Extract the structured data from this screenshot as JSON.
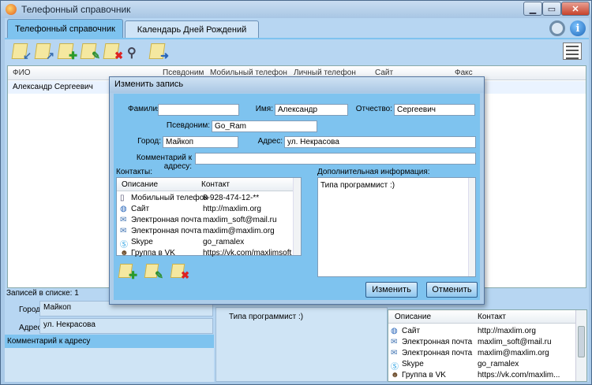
{
  "window": {
    "title": "Телефонный справочник"
  },
  "tabs": [
    {
      "label": "Телефонный справочник",
      "active": true
    },
    {
      "label": "Календарь Дней Рождений",
      "active": false
    }
  ],
  "toolbar": {
    "icons": [
      "import-icon",
      "export-icon",
      "add-icon",
      "edit-icon",
      "delete-icon",
      "search-icon",
      "send-icon"
    ],
    "right_icons": [
      "settings-icon",
      "info-icon",
      "list-view-icon"
    ]
  },
  "grid": {
    "columns": [
      "ФИО",
      "Псевдоним",
      "Мобильный телефон",
      "Личный телефон",
      "Сайт",
      "Факс"
    ],
    "rows": [
      {
        "fio": "Александр Сергеевич"
      }
    ]
  },
  "status": {
    "count_label": "Записей в списке: 1"
  },
  "details": {
    "city_label": "Город",
    "city_value": "Майкоп",
    "address_label": "Адрес",
    "address_value": "ул. Некрасова",
    "comment_header": "Комментарий к адресу",
    "info_text": "Типа программист :)"
  },
  "mini_contacts": {
    "columns": [
      "Описание",
      "Контакт"
    ],
    "rows": [
      {
        "desc": "Сайт",
        "value": "http://maxlim.org"
      },
      {
        "desc": "Электронная почта",
        "value": "maxlim_soft@mail.ru"
      },
      {
        "desc": "Электронная почта",
        "value": "maxlim@maxlim.org"
      },
      {
        "desc": "Skype",
        "value": "go_ramalex"
      },
      {
        "desc": "Группа в VK",
        "value": "https://vk.com/maxlim..."
      }
    ]
  },
  "dialog": {
    "title": "Изменить запись",
    "labels": {
      "last_name": "Фамилия:",
      "first_name": "Имя:",
      "patronymic": "Отчество:",
      "nickname": "Псевдоним:",
      "city": "Город:",
      "address": "Адрес:",
      "address_comment": "Комментарий к адресу:",
      "contacts": "Контакты:",
      "extra_info": "Дополнительная информация:"
    },
    "values": {
      "last_name": "",
      "first_name": "Александр",
      "patronymic": "Сергеевич",
      "nickname": "Go_Ram",
      "city": "Майкоп",
      "address": "ул. Некрасова",
      "address_comment": "",
      "extra_info": "Типа программист :)"
    },
    "contacts": {
      "columns": [
        "Описание",
        "Контакт"
      ],
      "rows": [
        {
          "desc": "Мобильный телефон",
          "value": "8-928-474-12-**",
          "icon": "phone-icon"
        },
        {
          "desc": "Сайт",
          "value": "http://maxlim.org",
          "icon": "globe-icon"
        },
        {
          "desc": "Электронная почта",
          "value": "maxlim_soft@mail.ru",
          "icon": "mail-icon"
        },
        {
          "desc": "Электронная почта",
          "value": "maxlim@maxlim.org",
          "icon": "mail-icon"
        },
        {
          "desc": "Skype",
          "value": "go_ramalex",
          "icon": "skype-icon"
        },
        {
          "desc": "Группа в VK",
          "value": "https://vk.com/maxlimsoft",
          "icon": "user-icon"
        }
      ]
    },
    "buttons": {
      "save": "Изменить",
      "cancel": "Отменить"
    }
  }
}
